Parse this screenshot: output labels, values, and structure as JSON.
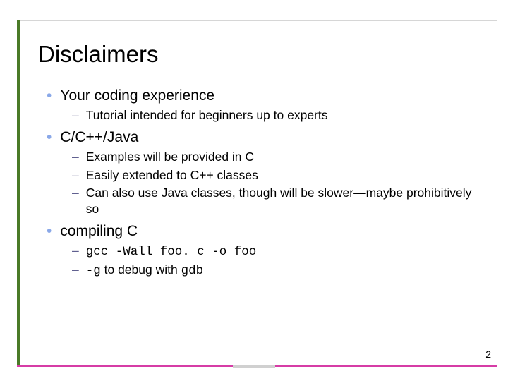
{
  "title": "Disclaimers",
  "pageNumber": "2",
  "b1": {
    "text": "Your coding experience"
  },
  "b1_1": {
    "text": "Tutorial intended for beginners up to experts"
  },
  "b2": {
    "text": "C/C++/Java"
  },
  "b2_1": {
    "text": "Examples will be provided in C"
  },
  "b2_2": {
    "text": "Easily extended to C++ classes"
  },
  "b2_3": {
    "text": "Can also use Java classes, though will be slower—maybe prohibitively so"
  },
  "b3": {
    "text": "compiling C"
  },
  "b3_1": {
    "code": "gcc -Wall foo. c -o foo"
  },
  "b3_2": {
    "code1": "-g",
    "mid": " to debug with ",
    "code2": "gdb"
  }
}
